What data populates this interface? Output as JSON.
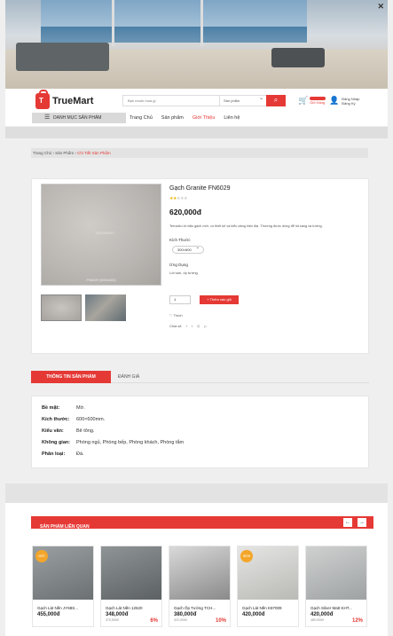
{
  "banner": {
    "close_label": "✕"
  },
  "header": {
    "logo_letter": "T",
    "logo_text": "TrueMart",
    "search_placeholder": "Bạn muốn mua gì",
    "search_category": "Sản phẩm",
    "cart_label": "Giỏ Hàng",
    "account_line1": "Đăng Nhập",
    "account_line2": "Đăng Ký"
  },
  "nav": {
    "category_button": "DANH MỤC SẢN PHẨM",
    "links": [
      "Trang Chủ",
      "Sản phẩm",
      "Giới Thiệu",
      "Liên hệ"
    ]
  },
  "breadcrumb": [
    "Trang Chủ",
    "Sản Phẩm",
    "Chi Tiết Sản Phẩm"
  ],
  "product": {
    "title": "Gạch Granite FN6029",
    "rating": 2,
    "rating_max": 5,
    "price": "620,000đ",
    "description": "Terracito là mẫu gạch mới, có thiết kế và kiểu dáng hiện đại. Thường được dùng để lót sàng và tường.",
    "size_label": "Kích Thước",
    "size_value": "300×600",
    "use_label": "Ứng Dụng",
    "use_value": "Lót sàn, ốp tường",
    "image_caption": "FN6029 (600x600)",
    "image_watermark": "TRUEMART",
    "quantity": "1",
    "add_button": "+ Thêm vào giỏ",
    "wishlist": "Thích",
    "share_label": "Chia sẻ"
  },
  "tabs": {
    "active": "THÔNG TIN SẢN PHẨM",
    "review": "ĐÁNH GIÁ"
  },
  "specs": [
    {
      "k": "Bề mặt:",
      "v": "Mờ."
    },
    {
      "k": "Kích thước:",
      "v": "600×600mm."
    },
    {
      "k": "Kiểu vân:",
      "v": "Bê tông."
    },
    {
      "k": "Không gian:",
      "v": "Phòng ngủ, Phòng bếp, Phòng khách, Phòng tắm"
    },
    {
      "k": "Phân loại:",
      "v": "Đá."
    }
  ],
  "related": {
    "title": "SẢN PHẨM LIÊN QUAN",
    "prev": "←",
    "next": "→",
    "items": [
      {
        "badge": "MỚI",
        "name": "Gạch Lát Nền JY68S...",
        "price": "455,000đ",
        "old": "",
        "discount": "",
        "colors": [
          "#9aa0a2",
          "#6b7073"
        ]
      },
      {
        "badge": "",
        "name": "Gạch Lát Nền 12620",
        "price": "348,000đ",
        "old": "370,500đ",
        "discount": "6%",
        "colors": [
          "#8f9496",
          "#5c6163"
        ]
      },
      {
        "badge": "",
        "name": "Gạch Ốp Tường TCH...",
        "price": "380,000đ",
        "old": "422,000đ",
        "discount": "10%",
        "colors": [
          "#d9d9d9",
          "#8a8a8a"
        ]
      },
      {
        "badge": "NEW",
        "name": "Gạch Lát Nền K87009",
        "price": "420,000đ",
        "old": "",
        "discount": "",
        "colors": [
          "#e5e5e3",
          "#b9bab6"
        ]
      },
      {
        "badge": "",
        "name": "Gạch Silver Matt KHT...",
        "price": "420,000đ",
        "old": "480,000đ",
        "discount": "12%",
        "colors": [
          "#cfd1d1",
          "#9fa2a2"
        ]
      }
    ]
  }
}
